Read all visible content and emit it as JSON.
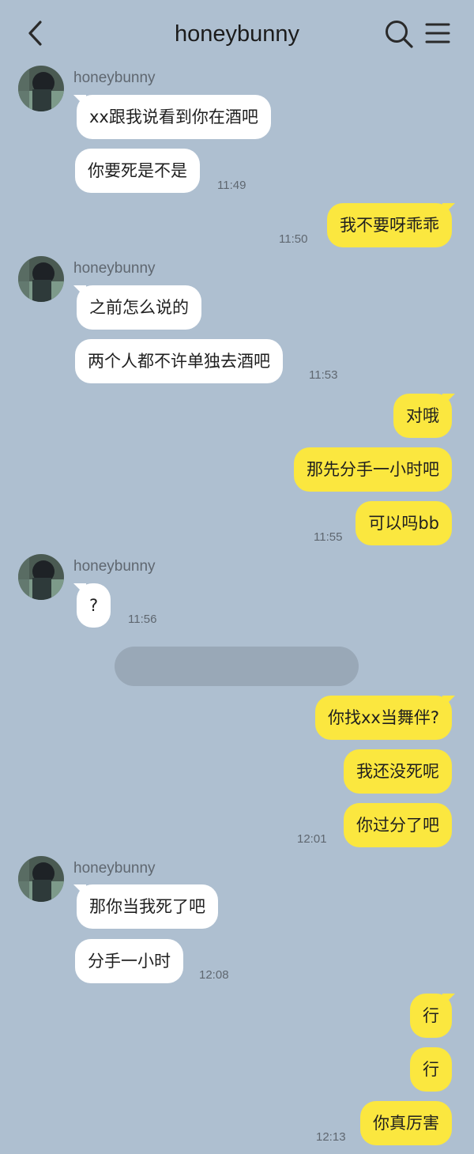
{
  "header": {
    "title": "honeybunny"
  },
  "messages": {
    "m1": {
      "sender": "honeybunny",
      "text": "xx跟我说看到你在酒吧"
    },
    "m2": {
      "text": "你要死是不是",
      "time": "11:49"
    },
    "m3": {
      "text": "我不要呀乖乖",
      "time": "11:50"
    },
    "m4": {
      "sender": "honeybunny",
      "text": "之前怎么说的"
    },
    "m5": {
      "text": "两个人都不许单独去酒吧",
      "time": "11:53"
    },
    "m6": {
      "text": "对哦"
    },
    "m7": {
      "text": "那先分手一小时吧"
    },
    "m8": {
      "text": "可以吗bb",
      "time": "11:55"
    },
    "m9": {
      "sender": "honeybunny",
      "text": "?",
      "time": "11:56"
    },
    "m10": {
      "text": "你找xx当舞伴?"
    },
    "m11": {
      "text": "我还没死呢"
    },
    "m12": {
      "text": "你过分了吧",
      "time": "12:01"
    },
    "m13": {
      "sender": "honeybunny",
      "text": "那你当我死了吧"
    },
    "m14": {
      "text": "分手一小时",
      "time": "12:08"
    },
    "m15": {
      "text": "行"
    },
    "m16": {
      "text": "行"
    },
    "m17": {
      "text": "你真厉害",
      "time": "12:13"
    }
  },
  "icons": {
    "back": "chevron-left-icon",
    "search": "search-icon",
    "menu": "hamburger-menu-icon"
  },
  "colors": {
    "background": "#aebfd0",
    "incoming_bubble": "#ffffff",
    "outgoing_bubble": "#fbe73f",
    "redacted_bar": "#99a8b7"
  }
}
